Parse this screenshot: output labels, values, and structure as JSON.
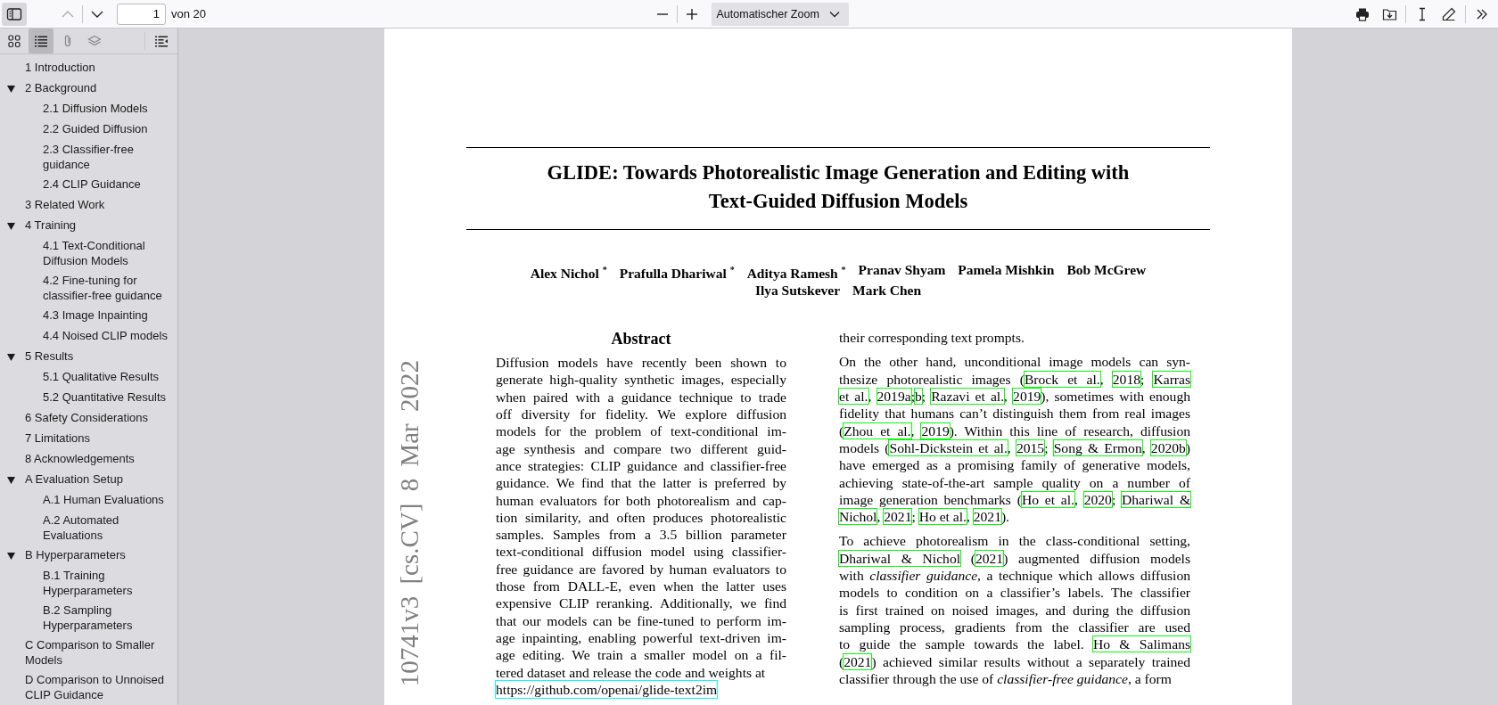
{
  "toolbar": {
    "sidebar_toggle": {
      "on": true
    },
    "previous_page": {
      "disabled": true
    },
    "next_page": {
      "disabled": false
    },
    "page_number": {
      "value": "1"
    },
    "page_count": "von 20",
    "zoom": {
      "value": "Automatischer Zoom"
    }
  },
  "sidebar": {
    "view_buttons": [
      {
        "kind": "thumbnails",
        "selected": false
      },
      {
        "kind": "outline",
        "selected": true
      },
      {
        "kind": "attachments",
        "selected": false
      },
      {
        "kind": "layers",
        "selected": false
      }
    ],
    "outline": [
      {
        "label": "1 Introduction"
      },
      {
        "label": "2 Background",
        "expanded": true,
        "children": [
          {
            "label": "2.1 Diffusion Models"
          },
          {
            "label": "2.2 Guided Diffusion"
          },
          {
            "label": "2.3 Classifier-free guidance"
          },
          {
            "label": "2.4 CLIP Guidance"
          }
        ]
      },
      {
        "label": "3 Related Work"
      },
      {
        "label": "4 Training",
        "expanded": true,
        "children": [
          {
            "label": "4.1 Text-Conditional Diffusion Models"
          },
          {
            "label": "4.2 Fine-tuning for classifier-free guidance"
          },
          {
            "label": "4.3 Image Inpainting"
          },
          {
            "label": "4.4 Noised CLIP models"
          }
        ]
      },
      {
        "label": "5 Results",
        "expanded": true,
        "children": [
          {
            "label": "5.1 Qualitative Results"
          },
          {
            "label": "5.2 Quantitative Results"
          }
        ]
      },
      {
        "label": "6 Safety Considerations"
      },
      {
        "label": "7 Limitations"
      },
      {
        "label": "8 Acknowledgements"
      },
      {
        "label": "A Evaluation Setup",
        "expanded": true,
        "children": [
          {
            "label": "A.1 Human Evaluations"
          },
          {
            "label": "A.2 Automated Evaluations"
          }
        ]
      },
      {
        "label": "B Hyperparameters",
        "expanded": true,
        "children": [
          {
            "label": "B.1 Training Hyperparameters"
          },
          {
            "label": "B.2 Sampling Hyperparameters"
          }
        ]
      },
      {
        "label": "C Comparison to Smaller Models"
      },
      {
        "label": "D Comparison to Unnoised CLIP Guidance"
      }
    ]
  },
  "page": {
    "arxiv_stamp": "10741v3 [cs.CV] 8 Mar 2022",
    "title": [
      "GLIDE: Towards Photorealistic Image Generation and Editing with",
      "Text-Guided Diffusion Models"
    ],
    "authors": [
      [
        "Alex Nichol $^{*}$",
        "Prafulla Dhariwal $^{*}$",
        "Aditya Ramesh $^{*}$",
        "Pranav Shyam",
        "Pamela Mishkin",
        "Bob McGrew"
      ],
      [
        "Ilya Sutskever",
        "Mark Chen"
      ]
    ],
    "abstract": {
      "heading": "Abstract",
      "lines": [
        "Diffusion models have recently been shown to",
        "generate high-quality synthetic images, especially",
        "when paired with a guidance technique to trade",
        "off diversity for fidelity. We explore diffusion",
        "models for the problem of text-conditional im-",
        "age synthesis and compare two different guid-",
        "ance strategies: CLIP guidance and classifier-free",
        "guidance. We find that the latter is preferred by",
        "human evaluators for both photorealism and cap-",
        "tion similarity, and often produces photorealistic",
        "samples. Samples from a 3.5 billion parameter",
        "text-conditional diffusion model using classifier-",
        "free guidance are favored by human evaluators to",
        "those from DALL-E, even when the latter uses",
        "expensive CLIP reranking. Additionally, we find",
        "that our models can be fine-tuned to perform im-",
        "age inpainting, enabling powerful text-driven im-",
        "age editing. We train a smaller model on a fil-",
        "tered dataset and release the code and weights at"
      ],
      "link": "https://github.com/openai/glide-text2im"
    },
    "right_column": [
      {
        "lines": [
          [
            {
              "kind": "text",
              "text": "their corresponding text prompts."
            }
          ]
        ]
      },
      {
        "lines": [
          [
            {
              "kind": "text",
              "text": "On the other hand, unconditional image models can syn-"
            }
          ],
          [
            {
              "kind": "text",
              "text": "thesize photorealistic images ("
            },
            {
              "kind": "link",
              "text": "Brock et al."
            },
            {
              "kind": "text",
              "text": ", "
            },
            {
              "kind": "link",
              "text": "2018"
            },
            {
              "kind": "text",
              "text": "; "
            },
            {
              "kind": "link",
              "text": "Karras"
            }
          ],
          [
            {
              "kind": "link",
              "text": "et al."
            },
            {
              "kind": "text",
              "text": ", "
            },
            {
              "kind": "link",
              "text": "2019a"
            },
            {
              "kind": "text",
              "text": ";"
            },
            {
              "kind": "link",
              "text": "b"
            },
            {
              "kind": "text",
              "text": "; "
            },
            {
              "kind": "link",
              "text": "Razavi et al."
            },
            {
              "kind": "text",
              "text": ", "
            },
            {
              "kind": "link",
              "text": "2019"
            },
            {
              "kind": "text",
              "text": "), sometimes with enough"
            }
          ],
          [
            {
              "kind": "text",
              "text": "fidelity that humans can’t distinguish them from real images"
            }
          ],
          [
            {
              "kind": "text",
              "text": "("
            },
            {
              "kind": "link",
              "text": "Zhou et al."
            },
            {
              "kind": "text",
              "text": ", "
            },
            {
              "kind": "link",
              "text": "2019"
            },
            {
              "kind": "text",
              "text": "). Within this line of research, diffusion"
            }
          ],
          [
            {
              "kind": "text",
              "text": "models ("
            },
            {
              "kind": "link",
              "text": "Sohl-Dickstein et al."
            },
            {
              "kind": "text",
              "text": ", "
            },
            {
              "kind": "link",
              "text": "2015"
            },
            {
              "kind": "text",
              "text": "; "
            },
            {
              "kind": "link",
              "text": "Song & Ermon"
            },
            {
              "kind": "text",
              "text": ", "
            },
            {
              "kind": "link",
              "text": "2020b"
            },
            {
              "kind": "text",
              "text": ")"
            }
          ],
          [
            {
              "kind": "text",
              "text": "have emerged as a promising family of generative models,"
            }
          ],
          [
            {
              "kind": "text",
              "text": "achieving state-of-the-art sample quality on a number of"
            }
          ],
          [
            {
              "kind": "text",
              "text": "image generation benchmarks ("
            },
            {
              "kind": "link",
              "text": "Ho et al."
            },
            {
              "kind": "text",
              "text": ", "
            },
            {
              "kind": "link",
              "text": "2020"
            },
            {
              "kind": "text",
              "text": "; "
            },
            {
              "kind": "link",
              "text": "Dhariwal &"
            }
          ],
          [
            {
              "kind": "link",
              "text": "Nichol"
            },
            {
              "kind": "text",
              "text": ", "
            },
            {
              "kind": "link",
              "text": "2021"
            },
            {
              "kind": "text",
              "text": "; "
            },
            {
              "kind": "link",
              "text": "Ho et al."
            },
            {
              "kind": "text",
              "text": ", "
            },
            {
              "kind": "link",
              "text": "2021"
            },
            {
              "kind": "text",
              "text": ")."
            }
          ]
        ]
      },
      {
        "lines": [
          [
            {
              "kind": "text",
              "text": "To achieve photorealism in the class-conditional setting,"
            }
          ],
          [
            {
              "kind": "link",
              "text": "Dhariwal & Nichol"
            },
            {
              "kind": "text",
              "text": " ("
            },
            {
              "kind": "link",
              "text": "2021"
            },
            {
              "kind": "text",
              "text": ") augmented diffusion models"
            }
          ],
          [
            {
              "kind": "text",
              "text": "with *classifier guidance*, a technique which allows diffusion"
            }
          ],
          [
            {
              "kind": "text",
              "text": "models to condition on a classifier’s labels. The classifier"
            }
          ],
          [
            {
              "kind": "text",
              "text": "is first trained on noised images, and during the diffusion"
            }
          ],
          [
            {
              "kind": "text",
              "text": "sampling process, gradients from the classifier are used"
            }
          ],
          [
            {
              "kind": "text",
              "text": "to guide the sample towards the label. "
            },
            {
              "kind": "link",
              "text": "Ho & Salimans"
            }
          ],
          [
            {
              "kind": "text",
              "text": "("
            },
            {
              "kind": "link",
              "text": "2021"
            },
            {
              "kind": "text",
              "text": ") achieved similar results without a separately trained"
            }
          ],
          [
            {
              "kind": "text",
              "text": "classifier through the use of *classifier-free guidance*, a form"
            }
          ]
        ]
      }
    ]
  }
}
